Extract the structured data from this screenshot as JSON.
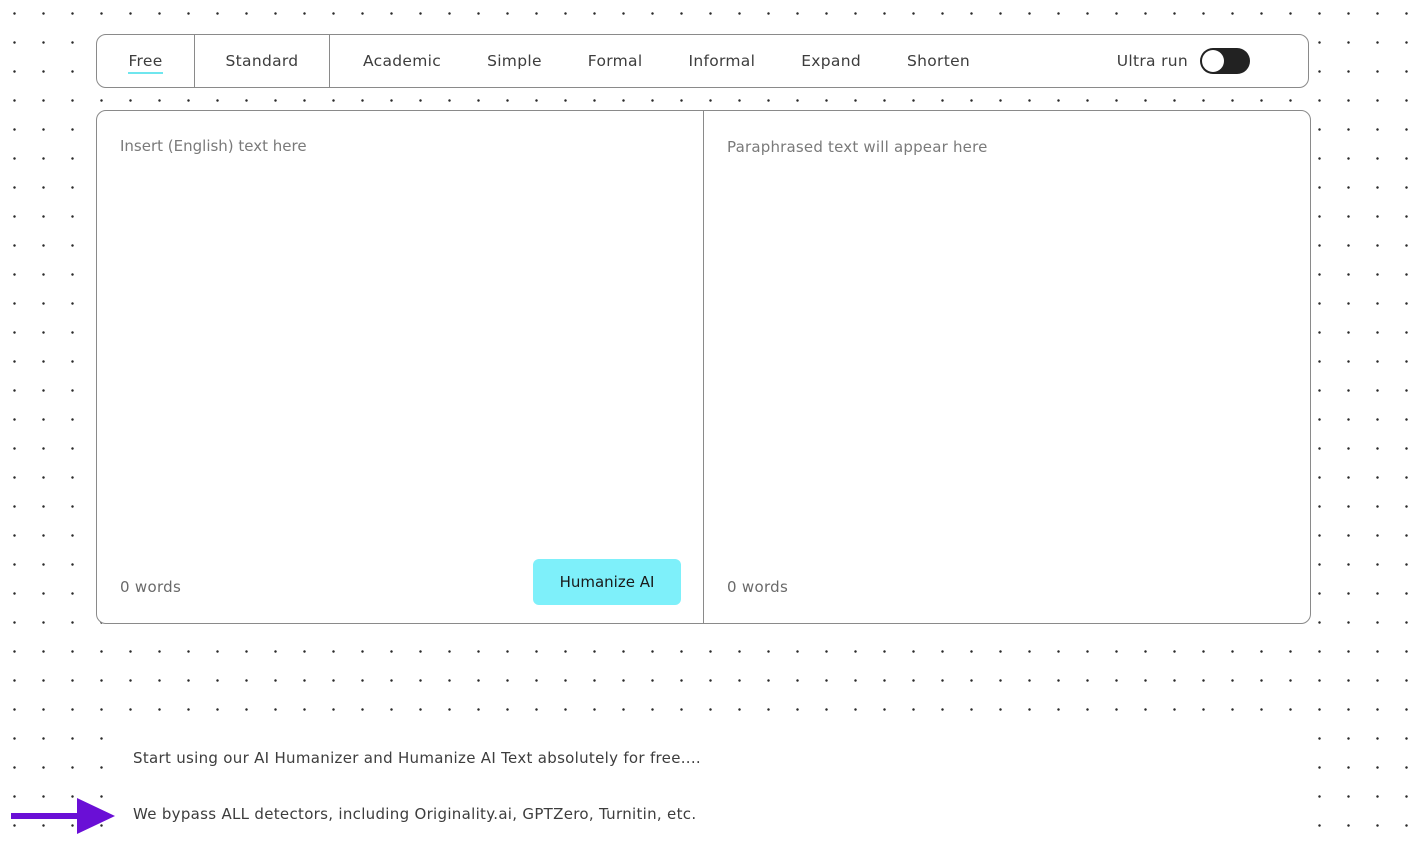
{
  "modes": {
    "free": "Free",
    "standard": "Standard",
    "academic": "Academic",
    "simple": "Simple",
    "formal": "Formal",
    "informal": "Informal",
    "expand": "Expand",
    "shorten": "Shorten",
    "selected": "Free"
  },
  "ultra_run": {
    "label": "Ultra run",
    "enabled": false
  },
  "input_pane": {
    "placeholder": "Insert (English) text here",
    "word_count": "0 words"
  },
  "output_pane": {
    "placeholder": "Paraphrased text will appear here",
    "word_count": "0 words"
  },
  "humanize_button": {
    "label": "Humanize AI",
    "color": "#7ef0fa"
  },
  "notes": {
    "line1": "Start using our AI Humanizer and Humanize AI Text absolutely for free....",
    "line2": "We bypass ALL detectors, including Originality.ai, GPTZero, Turnitin, etc."
  },
  "colors": {
    "accent": "#7ef0fa",
    "underline": "#6fe6ee",
    "arrow": "#6a0fd6",
    "toggle": "#222222"
  },
  "icons": {
    "pointer": "arrow-right-icon"
  }
}
